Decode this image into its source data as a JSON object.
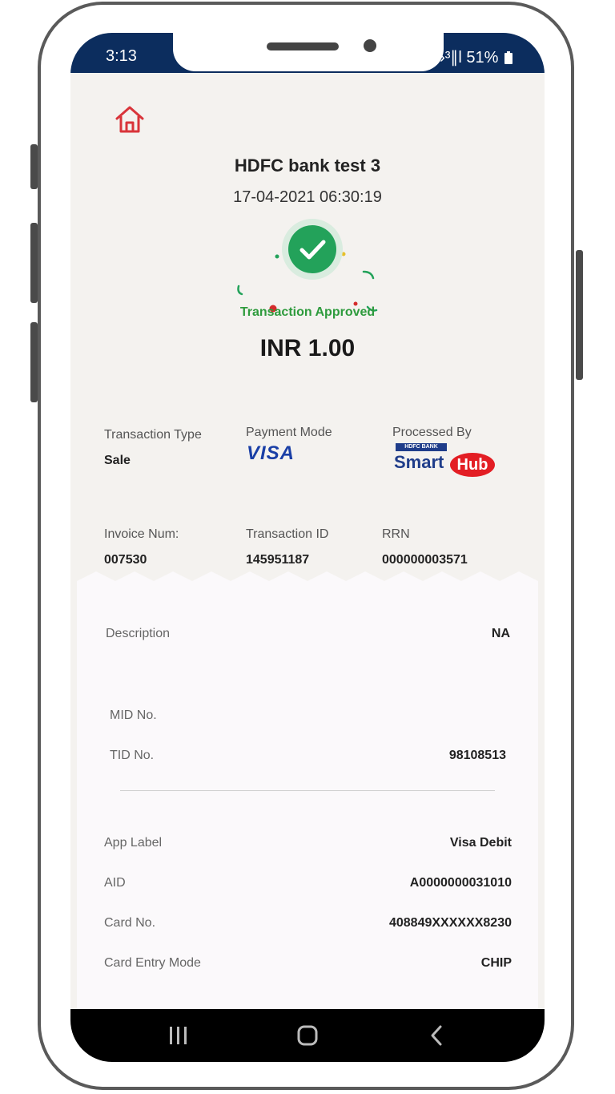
{
  "status_bar": {
    "time": "3:13",
    "indicators": "›³∥l 51%"
  },
  "header": {
    "home_icon": "home-icon",
    "merchant_name": "HDFC bank test 3",
    "datetime": "17-04-2021 06:30:19"
  },
  "status": {
    "icon": "check-icon",
    "text": "Transaction Approved",
    "color": "#2e9b3d"
  },
  "amount": "INR 1.00",
  "summary": {
    "transaction_type_label": "Transaction Type",
    "transaction_type_value": "Sale",
    "payment_mode_label": "Payment Mode",
    "payment_mode_logo": "VISA",
    "processed_by_label": "Processed By",
    "processed_by_logo": "HDFC BANK SmartHub"
  },
  "ids": {
    "invoice_label": "Invoice Num:",
    "invoice_value": "007530",
    "txn_id_label": "Transaction ID",
    "txn_id_value": "145951187",
    "rrn_label": "RRN",
    "rrn_value": "000000003571"
  },
  "receipt": {
    "description_label": "Description",
    "description_value": "NA",
    "mid_label": "MID No.",
    "mid_value": "",
    "tid_label": "TID No.",
    "tid_value": "98108513",
    "app_label_label": "App Label",
    "app_label_value": "Visa Debit",
    "aid_label": "AID",
    "aid_value": "A0000000031010",
    "card_no_label": "Card No.",
    "card_no_value": "408849XXXXXX8230",
    "entry_mode_label": "Card Entry Mode",
    "entry_mode_value": "CHIP"
  },
  "nav": {
    "recents": "recents-icon",
    "home": "home-button-icon",
    "back": "back-icon"
  },
  "colors": {
    "status_bar": "#0c2d5e",
    "accent_red": "#d9343a",
    "success_green": "#23a25a"
  }
}
